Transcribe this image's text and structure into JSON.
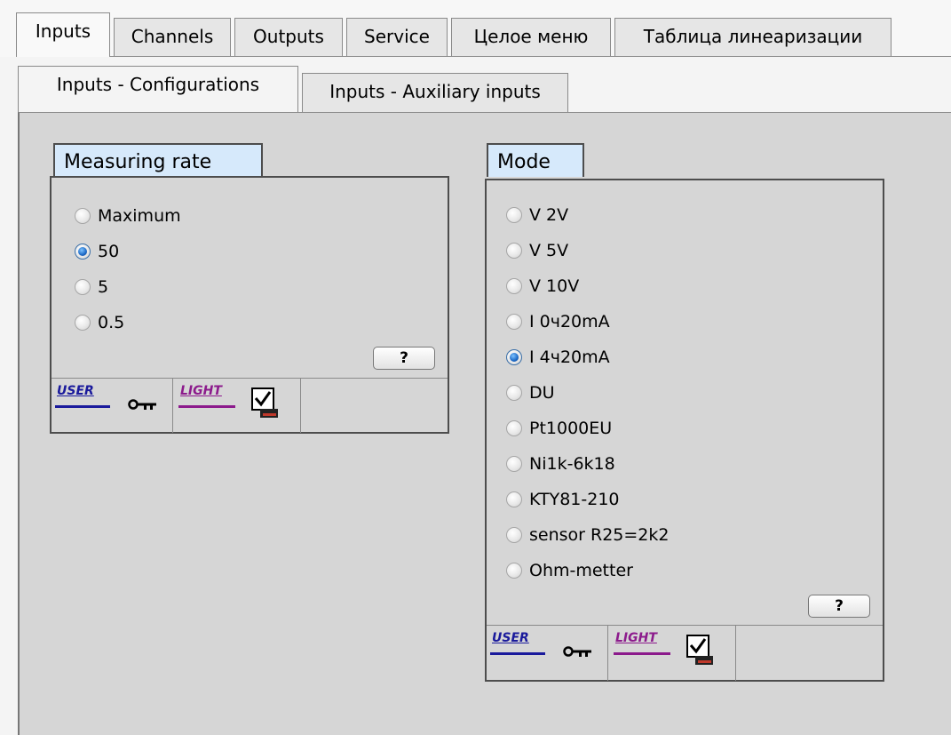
{
  "main_tabs": [
    {
      "label": "Inputs",
      "active": true
    },
    {
      "label": "Channels",
      "active": false
    },
    {
      "label": "Outputs",
      "active": false
    },
    {
      "label": "Service",
      "active": false
    },
    {
      "label": "Целое меню",
      "active": false
    },
    {
      "label": "Таблица линеаризации",
      "active": false
    }
  ],
  "sub_tabs": [
    {
      "label": "Inputs - Configurations",
      "active": true
    },
    {
      "label": "Inputs - Auxiliary inputs",
      "active": false
    }
  ],
  "measuring_rate": {
    "title": "Measuring rate",
    "options": [
      "Maximum",
      "50",
      "5",
      "0.5"
    ],
    "selected": "50",
    "help_label": "?",
    "footer": {
      "user_badge": "USER",
      "light_badge": "LIGHT"
    }
  },
  "mode": {
    "title": "Mode",
    "options": [
      "V 2V",
      "V 5V",
      "V 10V",
      "I 0ч20mA",
      "I 4ч20mA",
      "DU",
      "Pt1000EU",
      "Ni1k-6k18",
      "KTY81-210",
      "sensor R25=2k2",
      "Ohm-metter"
    ],
    "selected": "I 4ч20mA",
    "help_label": "?",
    "footer": {
      "user_badge": "USER",
      "light_badge": "LIGHT"
    }
  },
  "icons": {
    "key": "key-icon",
    "checkbox": "checkbox-monitor-icon"
  },
  "colors": {
    "panel_bg": "#d6d6d6",
    "group_title_bg": "#d6e9fb",
    "user_badge": "#1a1a9c",
    "light_badge": "#8c1a8c"
  }
}
